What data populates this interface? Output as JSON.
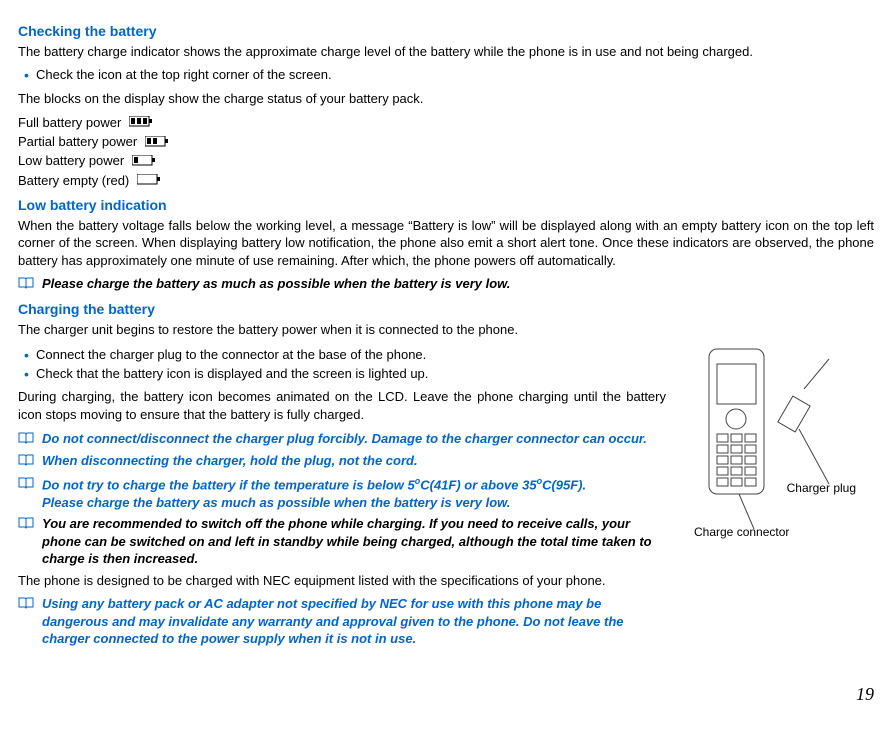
{
  "section1": {
    "title": "Checking the battery",
    "intro": "The battery charge indicator shows the approximate charge level of the battery while the phone is in use and not being charged.",
    "bullet1": "Check the icon at the top right corner of the screen.",
    "blocks_line": "The blocks on the display show the charge status of your battery pack.",
    "full": "Full battery power",
    "partial": "Partial battery power",
    "low": "Low battery power",
    "empty": "Battery empty (red)"
  },
  "section2": {
    "title": "Low battery indication",
    "body": "When the battery voltage falls below the working level, a message “Battery is low” will be displayed along with an empty battery icon on the top left corner of the screen. When displaying battery low notification, the phone also emit a short alert tone. Once these indicators are observed, the phone battery has approximately one minute of use remaining. After which, the phone powers off automatically.",
    "note": "Please charge the battery as much as possible when the battery is very low."
  },
  "section3": {
    "title": "Charging the battery",
    "intro": "The charger unit begins to restore the battery power when it is connected to the phone.",
    "bullet1": "Connect the charger plug to the connector at the base of the phone.",
    "bullet2": "Check that the battery icon is displayed and the screen is lighted up.",
    "during": "During charging, the battery icon becomes animated on the LCD. Leave the phone charging until the battery icon stops moving to ensure that the battery is fully charged.",
    "note1": "Do not connect/disconnect the charger plug forcibly. Damage to the charger connector can occur.",
    "note2": "When disconnecting the charger, hold the plug, not the cord.",
    "note3a": "Do not try to charge the battery if the temperature is below 5",
    "note3b": "C(41F) or above 35",
    "note3c": "C(95F).",
    "note3d": "Please charge the battery as much as possible when the battery is very low.",
    "note4": "You are recommended to switch off the phone while charging. If you need to receive calls, your phone can be switched on and left in standby while being charged, although the total time taken to charge is then increased.",
    "designed": "The phone is designed to be charged with NEC equipment listed with the specifications of your phone.",
    "note5": "Using any battery pack or AC adapter not specified by NEC for use with this phone may be dangerous and may invalidate any warranty and approval given to the phone. Do not leave the charger connected to the power supply when it is not in use."
  },
  "diagram": {
    "plug_label": "Charger plug",
    "connector_label": "Charge connector"
  },
  "page_number": "19"
}
